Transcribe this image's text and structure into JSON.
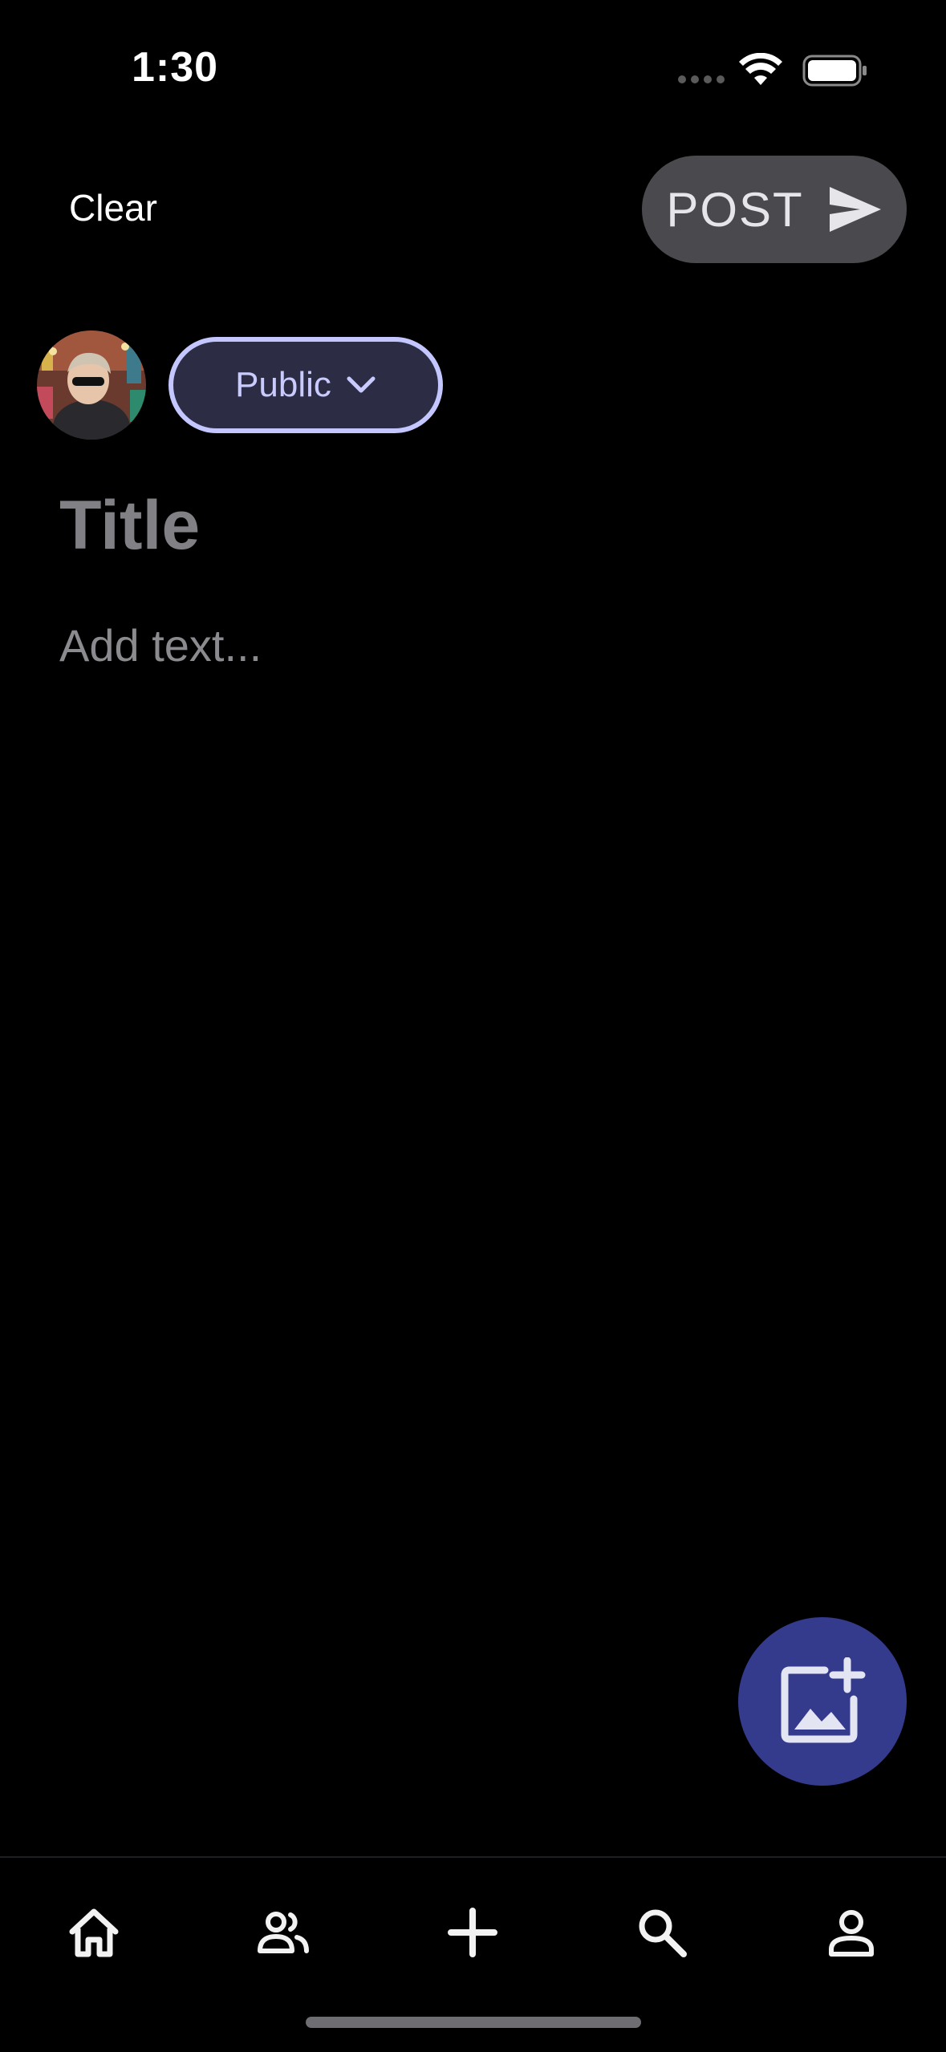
{
  "status_bar": {
    "time": "1:30"
  },
  "header": {
    "clear_label": "Clear",
    "post_label": "POST"
  },
  "audience": {
    "selected": "Public"
  },
  "composer": {
    "title_placeholder": "Title",
    "body_placeholder": "Add text..."
  },
  "colors": {
    "background": "#000000",
    "post_button_bg": "#4a4a4e",
    "audience_border": "#c3c6ff",
    "audience_bg": "#2c2d45",
    "fab_bg": "#343a8c"
  },
  "icons": {
    "send": "send-icon",
    "chevron": "chevron-down-icon",
    "add_image": "add-image-icon",
    "nav": [
      "home-icon",
      "people-icon",
      "plus-icon",
      "search-icon",
      "person-icon"
    ]
  }
}
